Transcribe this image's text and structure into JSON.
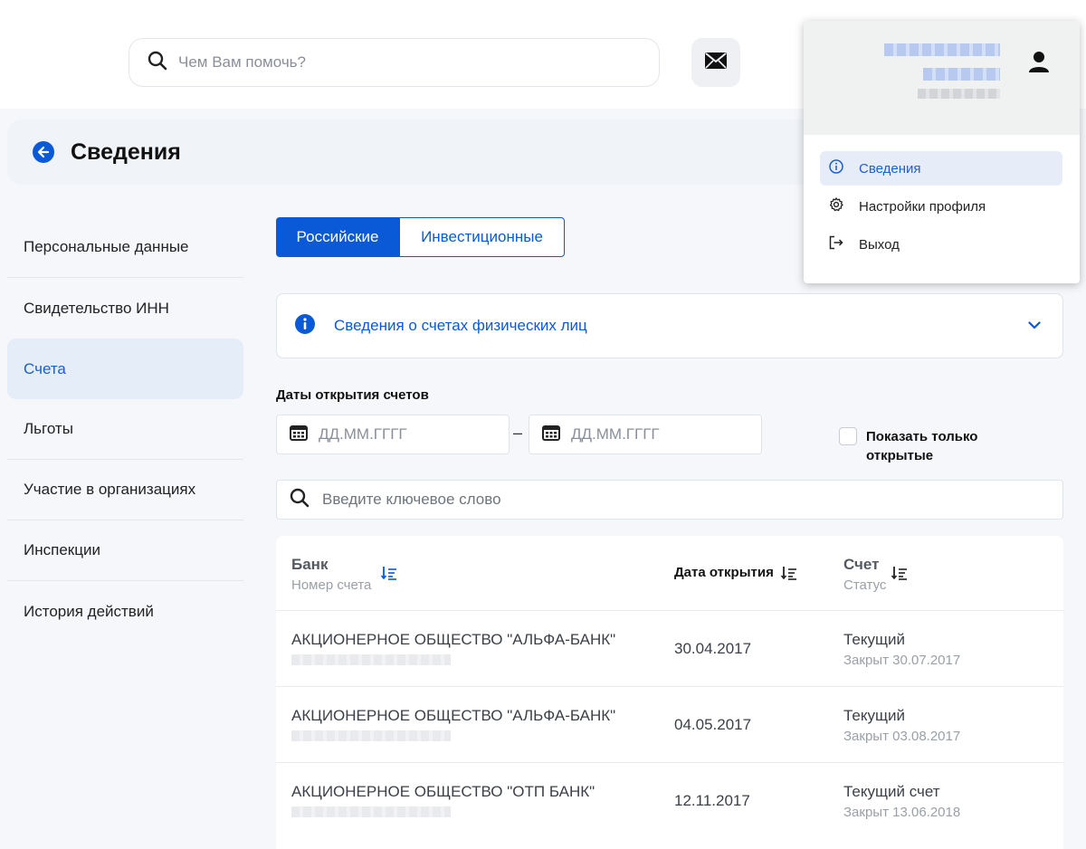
{
  "header": {
    "search_placeholder": "Чем Вам помочь?",
    "mail_icon": "envelope-icon"
  },
  "page": {
    "title": "Сведения"
  },
  "sidebar": {
    "items": [
      {
        "label": "Персональные данные",
        "active": false
      },
      {
        "label": "Свидетельство ИНН",
        "active": false
      },
      {
        "label": "Счета",
        "active": true
      },
      {
        "label": "Льготы",
        "active": false
      },
      {
        "label": "Участие в организациях",
        "active": false
      },
      {
        "label": "Инспекции",
        "active": false
      },
      {
        "label": "История действий",
        "active": false
      }
    ]
  },
  "tabs": {
    "russian": "Российские",
    "investment": "Инвестиционные"
  },
  "info": {
    "text": "Сведения о счетах физических лиц"
  },
  "filters": {
    "dates_label": "Даты открытия счетов",
    "date_from_placeholder": "ДД.ММ.ГГГГ",
    "date_to_placeholder": "ДД.ММ.ГГГГ",
    "dash": "–",
    "only_open_label": "Показать только открытые",
    "keyword_placeholder": "Введите ключевое слово"
  },
  "table": {
    "columns": {
      "bank": "Банк",
      "account_number": "Номер счета",
      "open_date": "Дата открытия",
      "account": "Счет",
      "status": "Статус"
    },
    "rows": [
      {
        "bank": "АКЦИОНЕРНОЕ ОБЩЕСТВО \"АЛЬФА-БАНК\"",
        "date": "30.04.2017",
        "account_type": "Текущий",
        "status": "Закрыт 30.07.2017"
      },
      {
        "bank": "АКЦИОНЕРНОЕ ОБЩЕСТВО \"АЛЬФА-БАНК\"",
        "date": "04.05.2017",
        "account_type": "Текущий",
        "status": "Закрыт 03.08.2017"
      },
      {
        "bank": "АКЦИОНЕРНОЕ ОБЩЕСТВО \"ОТП БАНК\"",
        "date": "12.11.2017",
        "account_type": "Текущий счет",
        "status": "Закрыт 13.06.2018"
      }
    ]
  },
  "dropdown": {
    "items": [
      {
        "label": "Сведения",
        "icon": "info-icon",
        "active": true
      },
      {
        "label": "Настройки профиля",
        "icon": "gear-icon",
        "active": false
      },
      {
        "label": "Выход",
        "icon": "logout-icon",
        "active": false
      }
    ]
  },
  "colors": {
    "accent": "#0a5ad8",
    "active_bg": "#e5edf8"
  }
}
